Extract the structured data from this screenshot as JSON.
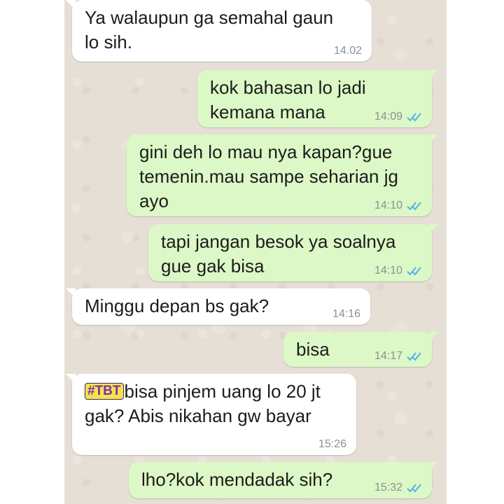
{
  "messages": [
    {
      "direction": "in",
      "text": "Ya walaupun ga semahal gaun\nlo sih.",
      "time": "14.02",
      "ticks": ""
    },
    {
      "direction": "out",
      "text": "kok bahasan lo jadi\nkemana mana",
      "time": "14:09",
      "ticks": "read"
    },
    {
      "direction": "out",
      "text": "gini deh lo mau nya kapan?gue\ntemenin.mau sampe seharian jg\nayo",
      "time": "14:10",
      "ticks": "read"
    },
    {
      "direction": "out",
      "text": "tapi jangan besok ya soalnya\ngue gak bisa",
      "time": "14:10",
      "ticks": "read"
    },
    {
      "direction": "in",
      "text": "Minggu depan bs gak?",
      "time": "14:16",
      "ticks": ""
    },
    {
      "direction": "out",
      "text": "bisa",
      "time": "14:17",
      "ticks": "read"
    },
    {
      "direction": "in",
      "tag": "#TBT",
      "text": "bisa pinjem uang lo 20 jt\ngak? Abis nikahan gw bayar",
      "time": "15:26",
      "ticks": ""
    },
    {
      "direction": "out",
      "text": "lho?kok mendadak sih?",
      "time": "15:32",
      "ticks": "read"
    }
  ],
  "colors": {
    "chat_background": "#e6dfd6",
    "incoming_bubble": "#ffffff",
    "outgoing_bubble": "#dcf8c6",
    "read_ticks": "#4fb3e8",
    "timestamp": "#8c9095"
  },
  "icons": {
    "read_receipt": "double-check-icon"
  }
}
